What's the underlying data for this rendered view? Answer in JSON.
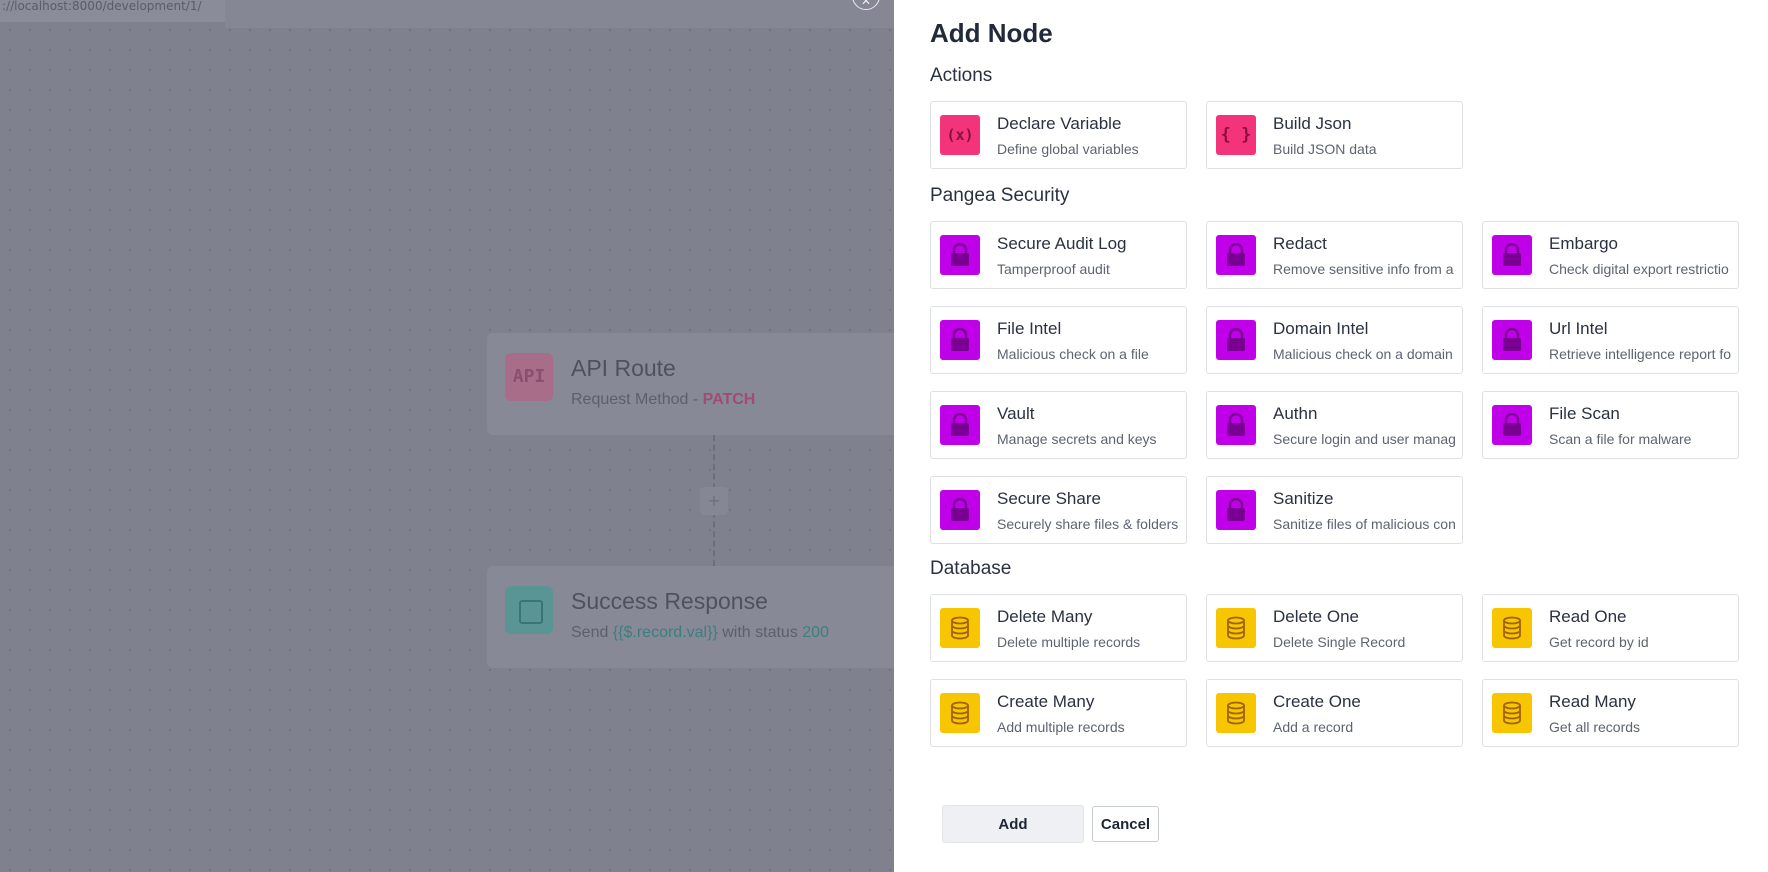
{
  "background": {
    "url": "://localhost:8000/development/1/",
    "api_node": {
      "icon_text": "API",
      "title": "API Route",
      "subtitle_prefix": "Request Method - ",
      "method": "PATCH"
    },
    "success_node": {
      "title": "Success Response",
      "send_prefix": "Send ",
      "send_value": "{{$.record.val}}",
      "status_prefix": " with status ",
      "status_code": "200"
    },
    "plus": "+"
  },
  "panel": {
    "title": "Add Node",
    "sections": {
      "actions": {
        "title": "Actions",
        "items": [
          {
            "title": "Declare Variable",
            "desc": "Define global variables",
            "icon": "variable-icon",
            "color": "#f4347a"
          },
          {
            "title": "Build Json",
            "desc": "Build JSON data",
            "icon": "braces-icon",
            "color": "#f4347a"
          }
        ]
      },
      "pangea": {
        "title": "Pangea Security",
        "items": [
          {
            "title": "Secure Audit Log",
            "desc": "Tamperproof audit",
            "icon": "lock-icon",
            "color": "#c000e8"
          },
          {
            "title": "Redact",
            "desc": "Remove sensitive info from a s",
            "icon": "lock-icon",
            "color": "#c000e8"
          },
          {
            "title": "Embargo",
            "desc": "Check digital export restrictio",
            "icon": "lock-icon",
            "color": "#c000e8"
          },
          {
            "title": "File Intel",
            "desc": "Malicious check on a file",
            "icon": "lock-icon",
            "color": "#c000e8"
          },
          {
            "title": "Domain Intel",
            "desc": "Malicious check on a domain",
            "icon": "lock-icon",
            "color": "#c000e8"
          },
          {
            "title": "Url Intel",
            "desc": "Retrieve intelligence report fo",
            "icon": "lock-icon",
            "color": "#c000e8"
          },
          {
            "title": "Vault",
            "desc": "Manage secrets and keys",
            "icon": "lock-icon",
            "color": "#c000e8"
          },
          {
            "title": "Authn",
            "desc": "Secure login and user manager",
            "icon": "lock-icon",
            "color": "#c000e8"
          },
          {
            "title": "File Scan",
            "desc": "Scan a file for malware",
            "icon": "lock-icon",
            "color": "#c000e8"
          },
          {
            "title": "Secure Share",
            "desc": "Securely share files & folders",
            "icon": "lock-icon",
            "color": "#c000e8"
          },
          {
            "title": "Sanitize",
            "desc": "Sanitize files of malicious cont",
            "icon": "lock-icon",
            "color": "#c000e8"
          }
        ]
      },
      "database": {
        "title": "Database",
        "items": [
          {
            "title": "Delete Many",
            "desc": "Delete multiple records",
            "icon": "database-icon",
            "color": "#f7c600"
          },
          {
            "title": "Delete One",
            "desc": "Delete Single Record",
            "icon": "database-icon",
            "color": "#f7c600"
          },
          {
            "title": "Read One",
            "desc": "Get record by id",
            "icon": "database-icon",
            "color": "#f7c600"
          },
          {
            "title": "Create Many",
            "desc": "Add multiple records",
            "icon": "database-icon",
            "color": "#f7c600"
          },
          {
            "title": "Create One",
            "desc": "Add a record",
            "icon": "database-icon",
            "color": "#f7c600"
          },
          {
            "title": "Read Many",
            "desc": "Get all records",
            "icon": "database-icon",
            "color": "#f7c600"
          }
        ]
      }
    },
    "buttons": {
      "add": "Add",
      "cancel": "Cancel"
    }
  }
}
